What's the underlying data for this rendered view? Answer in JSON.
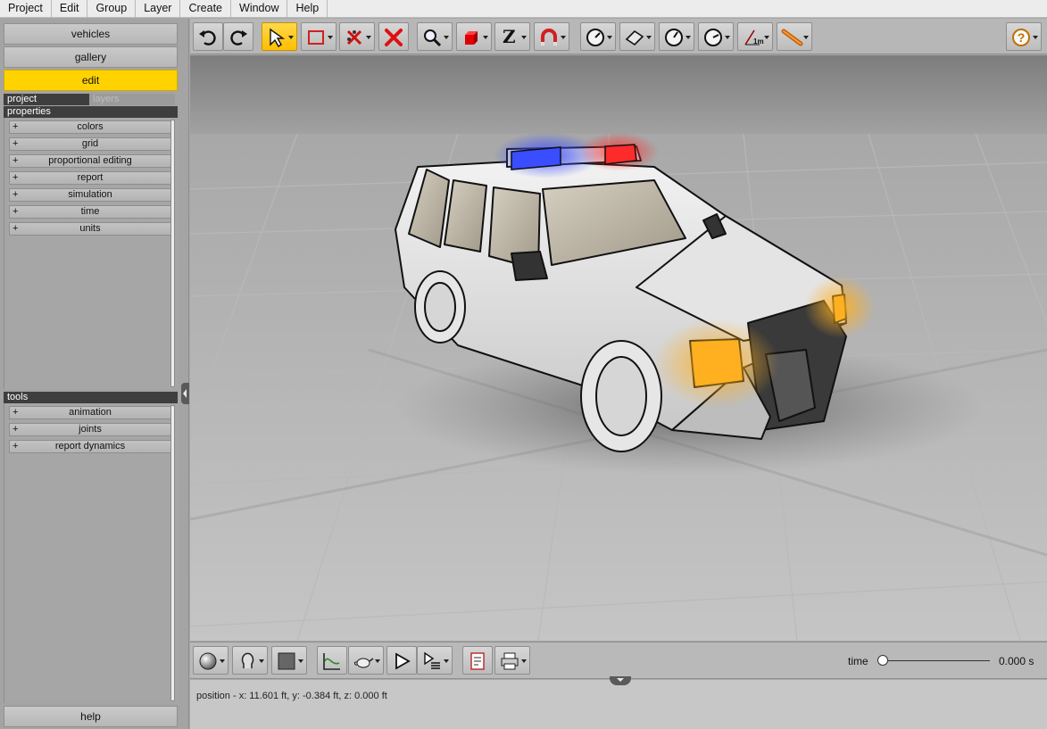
{
  "menu": [
    "Project",
    "Edit",
    "Group",
    "Layer",
    "Create",
    "Window",
    "Help"
  ],
  "nav": {
    "vehicles": "vehicles",
    "gallery": "gallery",
    "edit": "edit",
    "help": "help"
  },
  "tabs": {
    "project": "project",
    "layers": "layers"
  },
  "properties": {
    "header": "properties",
    "items": [
      "colors",
      "grid",
      "proportional editing",
      "report",
      "simulation",
      "time",
      "units"
    ]
  },
  "tools": {
    "header": "tools",
    "items": [
      "animation",
      "joints",
      "report dynamics"
    ]
  },
  "expand_symbol": "+",
  "toolbar": {
    "icons": [
      "undo-icon",
      "redo-icon",
      "select-arrow-icon",
      "box-select-icon",
      "delete-connections-icon",
      "delete-icon",
      "zoom-icon",
      "solid-cube-icon",
      "z-axis-icon",
      "magnet-icon",
      "gauge-icon",
      "plane-icon",
      "rotate-gauge-icon",
      "dial-icon",
      "measure-1m-icon",
      "wrench-tool-icon",
      "help-icon"
    ],
    "z_label": "Z",
    "measure_label": "1m"
  },
  "bottombar": {
    "time_label": "time",
    "time_value": "0.000 s",
    "time_position": 0
  },
  "status": "position - x: 11.601 ft, y: -0.384 ft, z: 0.000 ft",
  "colors": {
    "accent_yellow": "#ffd200",
    "siren_blue": "#3a4dff",
    "siren_red": "#ff2a2a",
    "headlight": "#ffb020",
    "delete_red": "#e01010"
  }
}
